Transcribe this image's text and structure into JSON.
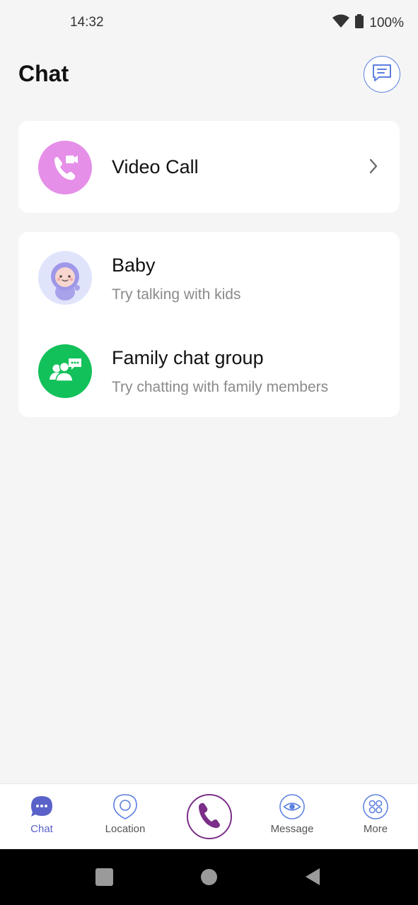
{
  "status_bar": {
    "time": "14:32",
    "battery": "100%"
  },
  "header": {
    "title": "Chat"
  },
  "video_call": {
    "label": "Video Call"
  },
  "chats": [
    {
      "title": "Baby",
      "subtitle": "Try talking with kids"
    },
    {
      "title": "Family chat group",
      "subtitle": "Try chatting with family members"
    }
  ],
  "tabs": [
    {
      "label": "Chat",
      "icon": "chat-bubble-icon",
      "active": true
    },
    {
      "label": "Location",
      "icon": "location-pin-icon"
    },
    {
      "label": "",
      "icon": "phone-icon"
    },
    {
      "label": "Message",
      "icon": "eye-icon"
    },
    {
      "label": "More",
      "icon": "grid-icon"
    }
  ],
  "colors": {
    "accent": "#5a62c9",
    "video_icon_bg": "#e58fe9",
    "family_icon_bg": "#12c15a",
    "call_button": "#7b2f88"
  }
}
